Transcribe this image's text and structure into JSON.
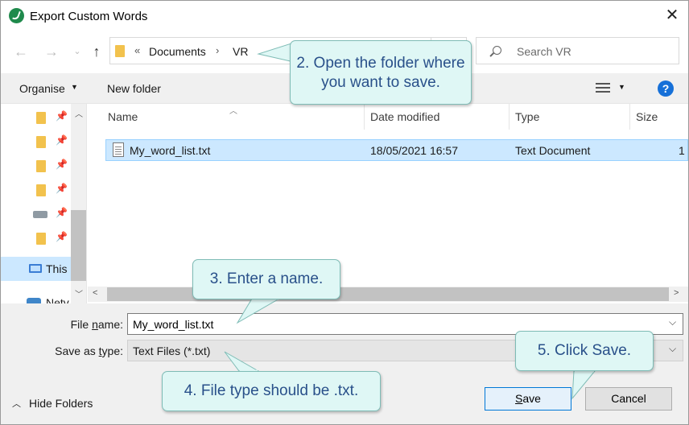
{
  "window": {
    "title": "Export Custom Words",
    "close_glyph": "✕"
  },
  "address": {
    "overflow": "«",
    "folder": "Documents",
    "separator": "›",
    "current": "VR"
  },
  "search": {
    "placeholder": "Search VR"
  },
  "toolbar": {
    "organise": "Organise",
    "new_folder": "New folder",
    "help": "?"
  },
  "nav_pane": {
    "this_pc_label": "This",
    "network_label": "Netv"
  },
  "columns": {
    "name": "Name",
    "date_modified": "Date modified",
    "type": "Type",
    "size": "Size"
  },
  "files": [
    {
      "name": "My_word_list.txt",
      "date": "18/05/2021 16:57",
      "type": "Text Document",
      "size": "1"
    }
  ],
  "form": {
    "file_name_label_pre": "File ",
    "file_name_label_u": "n",
    "file_name_label_post": "ame:",
    "file_name_value": "My_word_list.txt",
    "save_type_label_pre": "Save as ",
    "save_type_label_u": "t",
    "save_type_label_post": "ype:",
    "save_type_value": "Text Files (*.txt)"
  },
  "buttons": {
    "hide_folders": "Hide Folders",
    "save_u": "S",
    "save_rest": "ave",
    "cancel": "Cancel"
  },
  "callouts": {
    "step2_line1": "2. Open the folder where",
    "step2_line2": "you want to save.",
    "step3": "3. Enter a name.",
    "step4": "4. File type should be .txt.",
    "step5": "5. Click Save."
  },
  "colors": {
    "callout_fill": "#dff7f5",
    "callout_border": "#7fbcb6",
    "callout_text": "#29508a",
    "selection": "#cce8ff",
    "accent": "#0078d7"
  }
}
